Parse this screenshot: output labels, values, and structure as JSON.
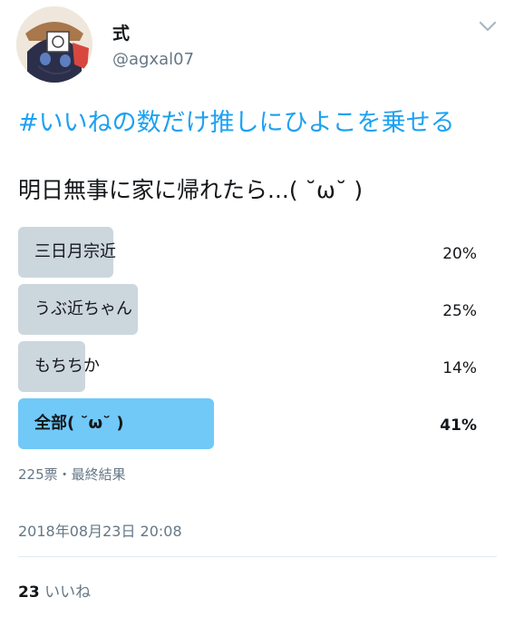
{
  "user": {
    "display_name": "式",
    "handle": "@agxal07",
    "avatar_icon": "user-avatar"
  },
  "tweet": {
    "hashtag": "#いいねの数だけ推しにひよこを乗せる",
    "text": "明日無事に家に帰れたら...( ˘ω˘ )"
  },
  "poll": {
    "options": [
      {
        "label": "三日月宗近",
        "percent_text": "20%",
        "percent": 20
      },
      {
        "label": "うぶ近ちゃん",
        "percent_text": "25%",
        "percent": 25
      },
      {
        "label": "もちちか",
        "percent_text": "14%",
        "percent": 14
      },
      {
        "label": "全部( ˘ω˘ )",
        "percent_text": "41%",
        "percent": 41
      }
    ],
    "meta": "225票・最終結果"
  },
  "timestamp": "2018年08月23日 20:08",
  "likes": {
    "count": "23",
    "label": "いいね"
  },
  "colors": {
    "accent": "#1da1f2",
    "bar": "#ccd6dd",
    "winning_bar": "#71c9f8",
    "secondary_text": "#657786"
  }
}
